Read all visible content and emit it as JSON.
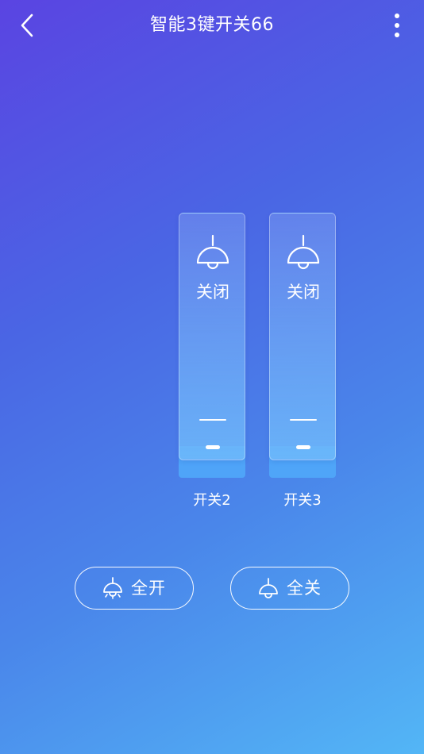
{
  "header": {
    "title": "智能3键开关66"
  },
  "switches": [
    {
      "name": "开关2",
      "state_label": "关闭"
    },
    {
      "name": "开关3",
      "state_label": "关闭"
    }
  ],
  "actions": {
    "all_on_label": "全开",
    "all_off_label": "全关"
  },
  "icons": {
    "back": "chevron-left-icon",
    "more": "more-vertical-icon",
    "lamp": "pendant-lamp-icon",
    "lamp_on": "pendant-lamp-on-icon"
  },
  "colors": {
    "gradient_start": "#5a44e2",
    "gradient_end": "#53b6f6",
    "text": "#ffffff"
  }
}
